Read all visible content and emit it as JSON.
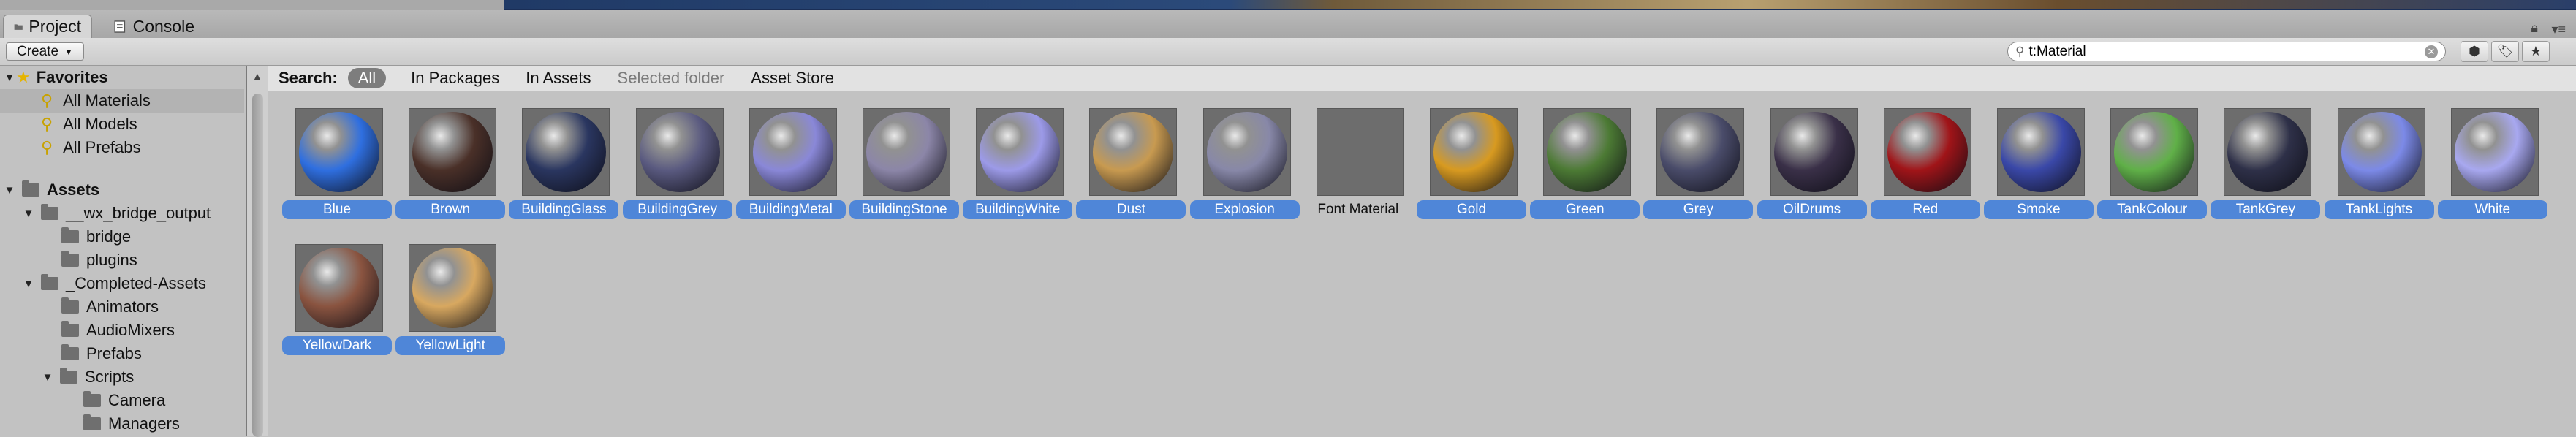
{
  "tabs": [
    {
      "label": "Project",
      "icon": "project-tab-icon",
      "active": true
    },
    {
      "label": "Console",
      "icon": "console-tab-icon",
      "active": false
    }
  ],
  "toolbar": {
    "create_label": "Create",
    "search_value": "t:Material",
    "search_placeholder": ""
  },
  "sidebar": {
    "favorites_label": "Favorites",
    "favorites": [
      "All Materials",
      "All Models",
      "All Prefabs"
    ],
    "assets_label": "Assets",
    "folders": [
      "__wx_bridge_output",
      "bridge",
      "plugins",
      "_Completed-Assets",
      "Animators",
      "AudioMixers",
      "Prefabs",
      "Scripts",
      "Camera",
      "Managers"
    ]
  },
  "filter": {
    "search_label": "Search:",
    "scopes": [
      "All",
      "In Packages",
      "In Assets",
      "Selected folder",
      "Asset Store"
    ]
  },
  "materials": [
    {
      "name": "Blue",
      "color": "#2f6fe0"
    },
    {
      "name": "Brown",
      "color": "#4a3028"
    },
    {
      "name": "BuildingGlass",
      "color": "#2a3660"
    },
    {
      "name": "BuildingGrey",
      "color": "#5a5a80"
    },
    {
      "name": "BuildingMetal",
      "color": "#8a88d8"
    },
    {
      "name": "BuildingStone",
      "color": "#8c86a8"
    },
    {
      "name": "BuildingWhite",
      "color": "#9c9ae8"
    },
    {
      "name": "Dust",
      "color": "#c89a50"
    },
    {
      "name": "Explosion",
      "color": "#8888a8"
    },
    {
      "name": "Font Material",
      "color": "#6d6d6d"
    },
    {
      "name": "Gold",
      "color": "#d89a20"
    },
    {
      "name": "Green",
      "color": "#4c7a34"
    },
    {
      "name": "Grey",
      "color": "#4a4c6a"
    },
    {
      "name": "OilDrums",
      "color": "#3a3048"
    },
    {
      "name": "Red",
      "color": "#a01418"
    },
    {
      "name": "Smoke",
      "color": "#3a48a8"
    },
    {
      "name": "TankColour",
      "color": "#60b048"
    },
    {
      "name": "TankGrey",
      "color": "#2e3048"
    },
    {
      "name": "TankLights",
      "color": "#7c8ae8"
    },
    {
      "name": "White",
      "color": "#a8a8f0"
    },
    {
      "name": "YellowDark",
      "color": "#8a5440"
    },
    {
      "name": "YellowLight",
      "color": "#d8a860"
    }
  ]
}
